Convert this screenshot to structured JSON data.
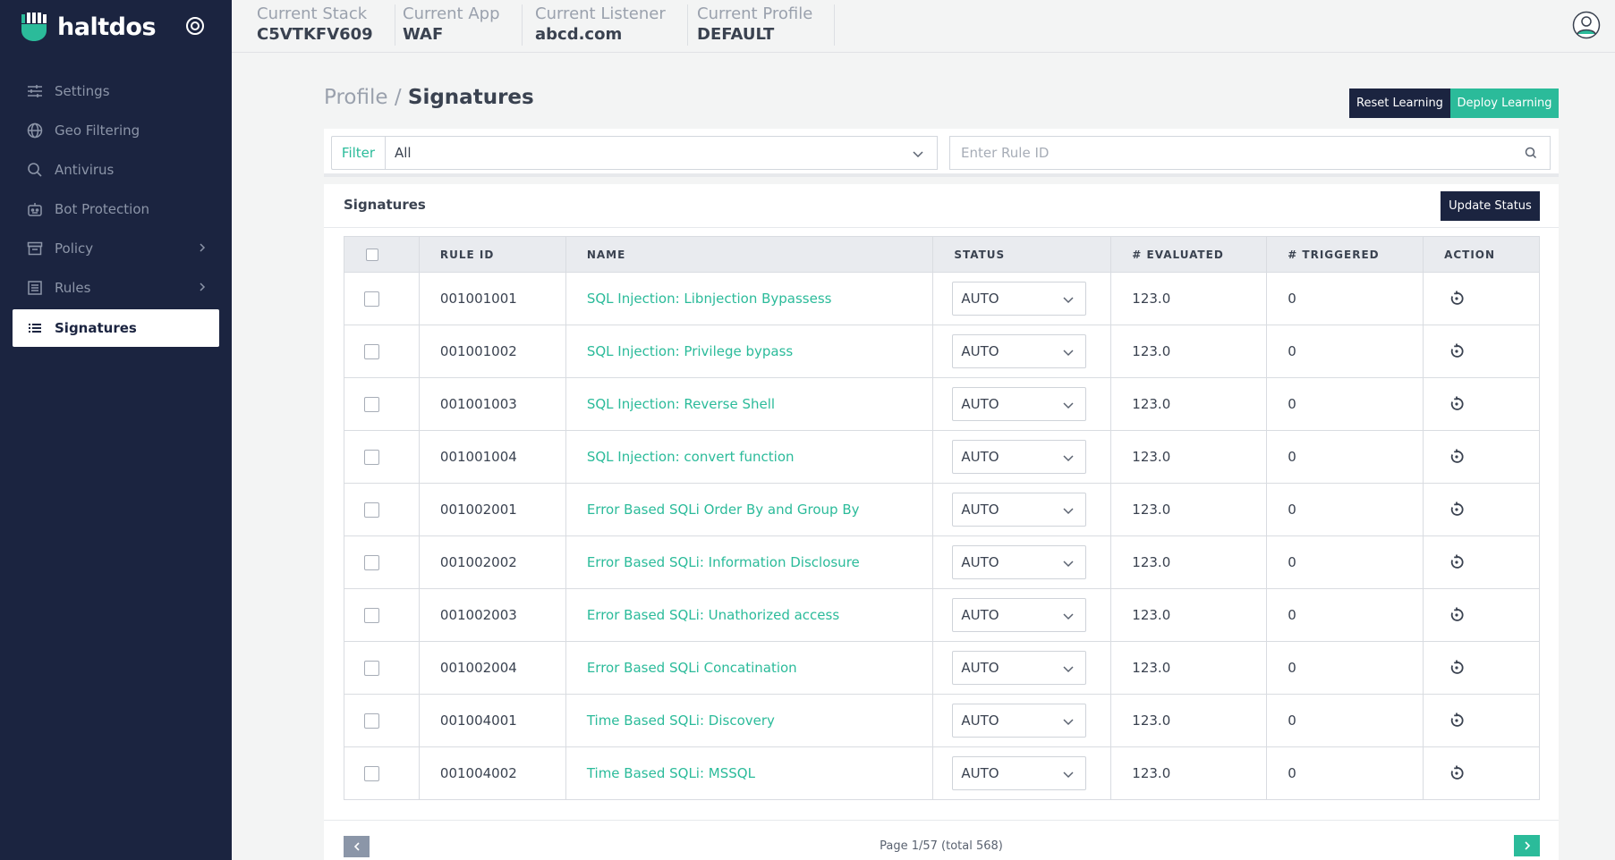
{
  "brand": {
    "name": "haltdos"
  },
  "sidebar": {
    "items": [
      {
        "label": "Settings",
        "icon": "sliders-icon"
      },
      {
        "label": "Geo Filtering",
        "icon": "globe-icon"
      },
      {
        "label": "Antivirus",
        "icon": "search-icon"
      },
      {
        "label": "Bot Protection",
        "icon": "robot-icon"
      },
      {
        "label": "Policy",
        "icon": "archive-icon"
      },
      {
        "label": "Rules",
        "icon": "list-box-icon"
      },
      {
        "label": "Signatures",
        "icon": "list-icon"
      }
    ]
  },
  "header": {
    "stack_label": "Current Stack",
    "stack_value": "C5VTKFV609",
    "app_label": "Current App",
    "app_value": "WAF",
    "listener_label": "Current Listener",
    "listener_value": "abcd.com",
    "profile_label": "Current Profile",
    "profile_value": "DEFAULT"
  },
  "page": {
    "breadcrumb_parent": "Profile",
    "breadcrumb_sep": "/",
    "title": "Signatures",
    "reset_label": "Reset Learning",
    "deploy_label": "Deploy Learning"
  },
  "filter": {
    "label": "Filter",
    "value": "All",
    "search_placeholder": "Enter Rule ID"
  },
  "table": {
    "title": "Signatures",
    "update_label": "Update Status",
    "columns": [
      "RULE ID",
      "NAME",
      "STATUS",
      "# EVALUATED",
      "# TRIGGERED",
      "ACTION"
    ],
    "rows": [
      {
        "id": "001001001",
        "name": "SQL Injection: Libnjection Bypassess",
        "status": "AUTO",
        "evaluated": "123.0",
        "triggered": "0"
      },
      {
        "id": "001001002",
        "name": "SQL Injection: Privilege bypass",
        "status": "AUTO",
        "evaluated": "123.0",
        "triggered": "0"
      },
      {
        "id": "001001003",
        "name": "SQL Injection: Reverse Shell",
        "status": "AUTO",
        "evaluated": "123.0",
        "triggered": "0"
      },
      {
        "id": "001001004",
        "name": "SQL Injection: convert function",
        "status": "AUTO",
        "evaluated": "123.0",
        "triggered": "0"
      },
      {
        "id": "001002001",
        "name": "Error Based SQLi Order By and Group By",
        "status": "AUTO",
        "evaluated": "123.0",
        "triggered": "0"
      },
      {
        "id": "001002002",
        "name": "Error Based SQLi: Information Disclosure",
        "status": "AUTO",
        "evaluated": "123.0",
        "triggered": "0"
      },
      {
        "id": "001002003",
        "name": "Error Based SQLi: Unathorized access",
        "status": "AUTO",
        "evaluated": "123.0",
        "triggered": "0"
      },
      {
        "id": "001002004",
        "name": "Error Based SQLi Concatination",
        "status": "AUTO",
        "evaluated": "123.0",
        "triggered": "0"
      },
      {
        "id": "001004001",
        "name": "Time Based SQLi: Discovery",
        "status": "AUTO",
        "evaluated": "123.0",
        "triggered": "0"
      },
      {
        "id": "001004002",
        "name": "Time Based SQLi: MSSQL",
        "status": "AUTO",
        "evaluated": "123.0",
        "triggered": "0"
      }
    ]
  },
  "pagination": {
    "text": "Page 1/57 (total 568)"
  },
  "colors": {
    "sidebar": "#1b2440",
    "accent": "#2bbb9a",
    "dark_button": "#1b2440"
  }
}
